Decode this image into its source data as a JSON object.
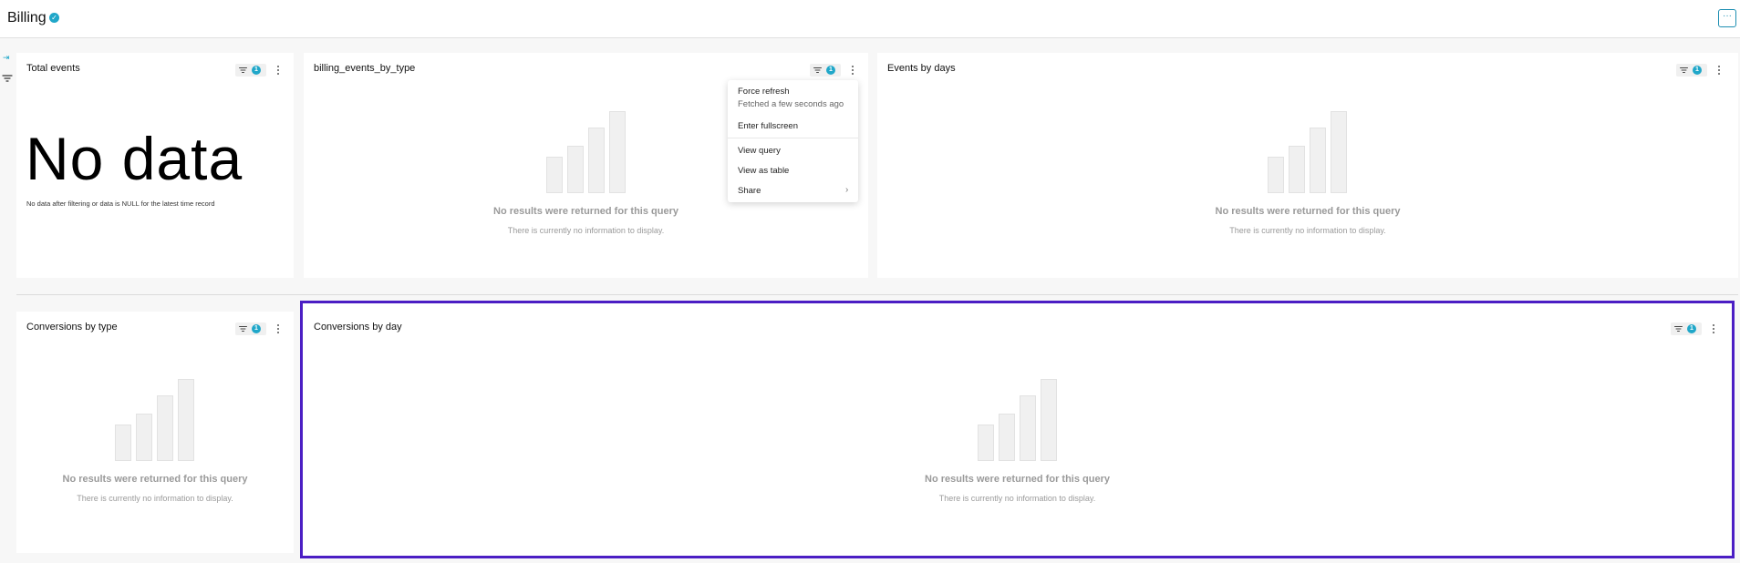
{
  "dashboard": {
    "title": "Billing",
    "more_label": "···",
    "verified_glyph": "✓",
    "expand_glyph": "⇥"
  },
  "filter_badge": "1",
  "empty_state": {
    "message": "No results were returned for this query",
    "sub": "There is currently no information to display."
  },
  "cards": {
    "total_events": {
      "title": "Total events",
      "big_value": "No data",
      "big_sub": "No data after filtering or data is NULL for the latest time record"
    },
    "billing_events_by_type": {
      "title": "billing_events_by_type"
    },
    "events_by_days": {
      "title": "Events by days"
    },
    "conversions_by_type": {
      "title": "Conversions by type"
    },
    "conversions_by_day": {
      "title": "Conversions by day"
    }
  },
  "menu": {
    "force_refresh": "Force refresh",
    "fetched": "Fetched a few seconds ago",
    "fullscreen": "Enter fullscreen",
    "view_query": "View query",
    "view_table": "View as table",
    "share": "Share",
    "chevron": "›"
  },
  "colors": {
    "accent": "#20a7c9",
    "selection": "#4b1ec4"
  }
}
